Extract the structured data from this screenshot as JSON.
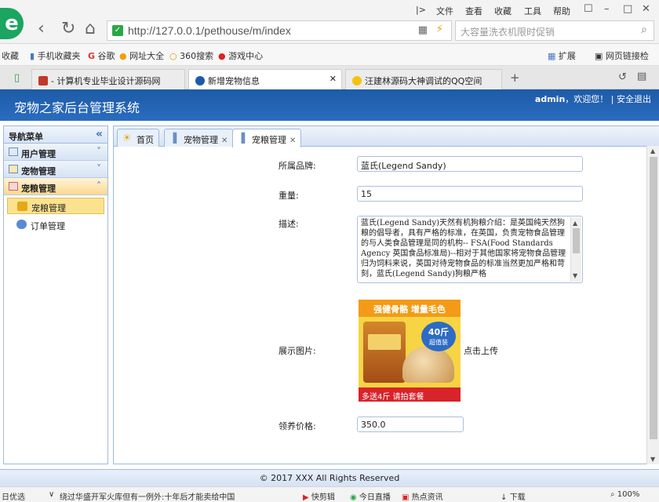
{
  "browser": {
    "address_url": "http://127.0.0.1/pethouse/m/index",
    "search_placeholder": "大容量洗衣机限时促销",
    "menu": [
      "文件",
      "查看",
      "收藏",
      "工具",
      "帮助"
    ],
    "bookmarks": [
      "收藏",
      "手机收藏夹",
      "谷歌",
      "网址大全",
      "360搜索",
      "游戏中心"
    ],
    "bookmarks_right": [
      "扩展",
      "网页链接检"
    ],
    "tabs": [
      {
        "label": "- 计算机专业毕业设计源码网"
      },
      {
        "label": "新增宠物信息"
      },
      {
        "label": "汪建林源码大神调试的QQ空间"
      }
    ]
  },
  "app": {
    "title": "宠物之家后台管理系统",
    "user": "admin",
    "welcome": "，欢迎您！",
    "logout": "安全退出"
  },
  "sidebar": {
    "header": "导航菜单",
    "sections": [
      {
        "label": "用户管理"
      },
      {
        "label": "宠物管理"
      },
      {
        "label": "宠粮管理"
      }
    ],
    "items": [
      {
        "label": "宠粮管理"
      },
      {
        "label": "订单管理"
      }
    ]
  },
  "content_tabs": [
    {
      "label": "首页"
    },
    {
      "label": "宠物管理"
    },
    {
      "label": "宠粮管理"
    }
  ],
  "form": {
    "brand_label": "所属品牌:",
    "brand_value": "蓝氏(Legend Sandy)",
    "weight_label": "重量:",
    "weight_value": "15",
    "desc_label": "描述:",
    "desc_value": "蓝氏(Legend Sandy)天然有机狗粮介绍：是英国纯天然狗粮的倡导者，具有严格的标准，在英国，负责宠物食品管理的与人类食品管理是同的机构-- FSA(Food Standards Agency 英国食品标准局)--相对于其他国家将宠物食品管理归为饲料来说，英国对待宠物食品的标准当然更加严格和苛刻，蓝氏(Legend Sandy)狗粮严格",
    "image_label": "展示图片:",
    "upload_label": "点击上传",
    "price_label": "领养价格:",
    "price_value": "350.0",
    "product_image": {
      "banner": "强健骨骼 增量毛色",
      "badge_top": "40斤",
      "badge_bottom": "超值装",
      "footer": "多送4斤 请拍套餐"
    }
  },
  "footer": {
    "text": "© 2017 XXX All Rights Reserved"
  },
  "statusbar": {
    "left": "日优选",
    "news": "绕过华盛开军火库但有一例外:十年后才能卖给中国",
    "items": [
      "快剪辑",
      "今日直播",
      "热点资讯",
      "下载",
      "100%"
    ]
  }
}
